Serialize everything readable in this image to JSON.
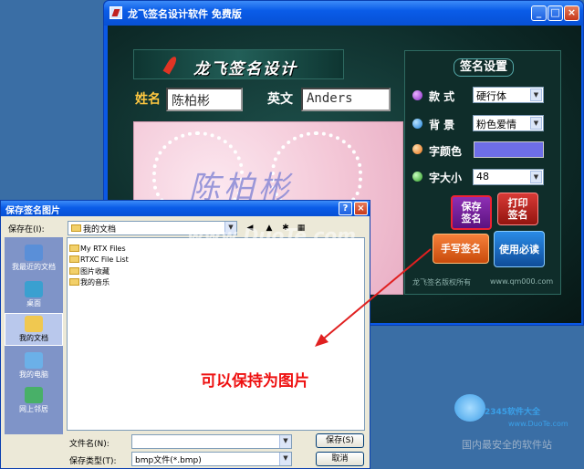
{
  "app": {
    "title": "龙飞签名设计软件  免费版",
    "banner": "龙飞签名设计",
    "name_label": "姓名",
    "name_value": "陈柏彬",
    "english_label": "英文",
    "english_value": "Anders",
    "preview_signature": "陈柏彬",
    "settings": {
      "title": "签名设置",
      "style_label": "款  式",
      "style_value": "硬行体",
      "background_label": "背  景",
      "background_value": "粉色爱情",
      "color_label": "字颜色",
      "color_value": "#6e6ee8",
      "size_label": "字大小",
      "size_value": "48"
    },
    "buttons": {
      "save": "保存签名",
      "print": "打印签名",
      "handwrite": "手写签名",
      "must_read": "使用必读"
    },
    "copyright": "龙飞签名版权所有",
    "website": "www.qm000.com",
    "min": "_",
    "max": "□",
    "close": "×"
  },
  "dialog": {
    "title": "保存签名图片",
    "help": "?",
    "close": "×",
    "save_in_label": "保存在(I):",
    "save_in_value": "我的文档",
    "places": [
      {
        "label": "我最近的文档"
      },
      {
        "label": "桌面"
      },
      {
        "label": "我的文档"
      },
      {
        "label": "我的电脑"
      },
      {
        "label": "网上邻居"
      }
    ],
    "files": [
      {
        "name": "My RTX Files"
      },
      {
        "name": "RTXC File List"
      },
      {
        "name": "图片收藏"
      },
      {
        "name": "我的音乐"
      }
    ],
    "filename_label": "文件名(N):",
    "filename_value": "",
    "filetype_label": "保存类型(T):",
    "filetype_value": "bmp文件(*.bmp)",
    "save_button": "保存(S)",
    "cancel_button": "取消"
  },
  "annotation": "可以保持为图片",
  "watermark": {
    "duote": "www.DuoTe.com",
    "brand": "2345软件大全",
    "brand_url": "www.DuoTe.com",
    "slogan": "国内最安全的软件站"
  }
}
